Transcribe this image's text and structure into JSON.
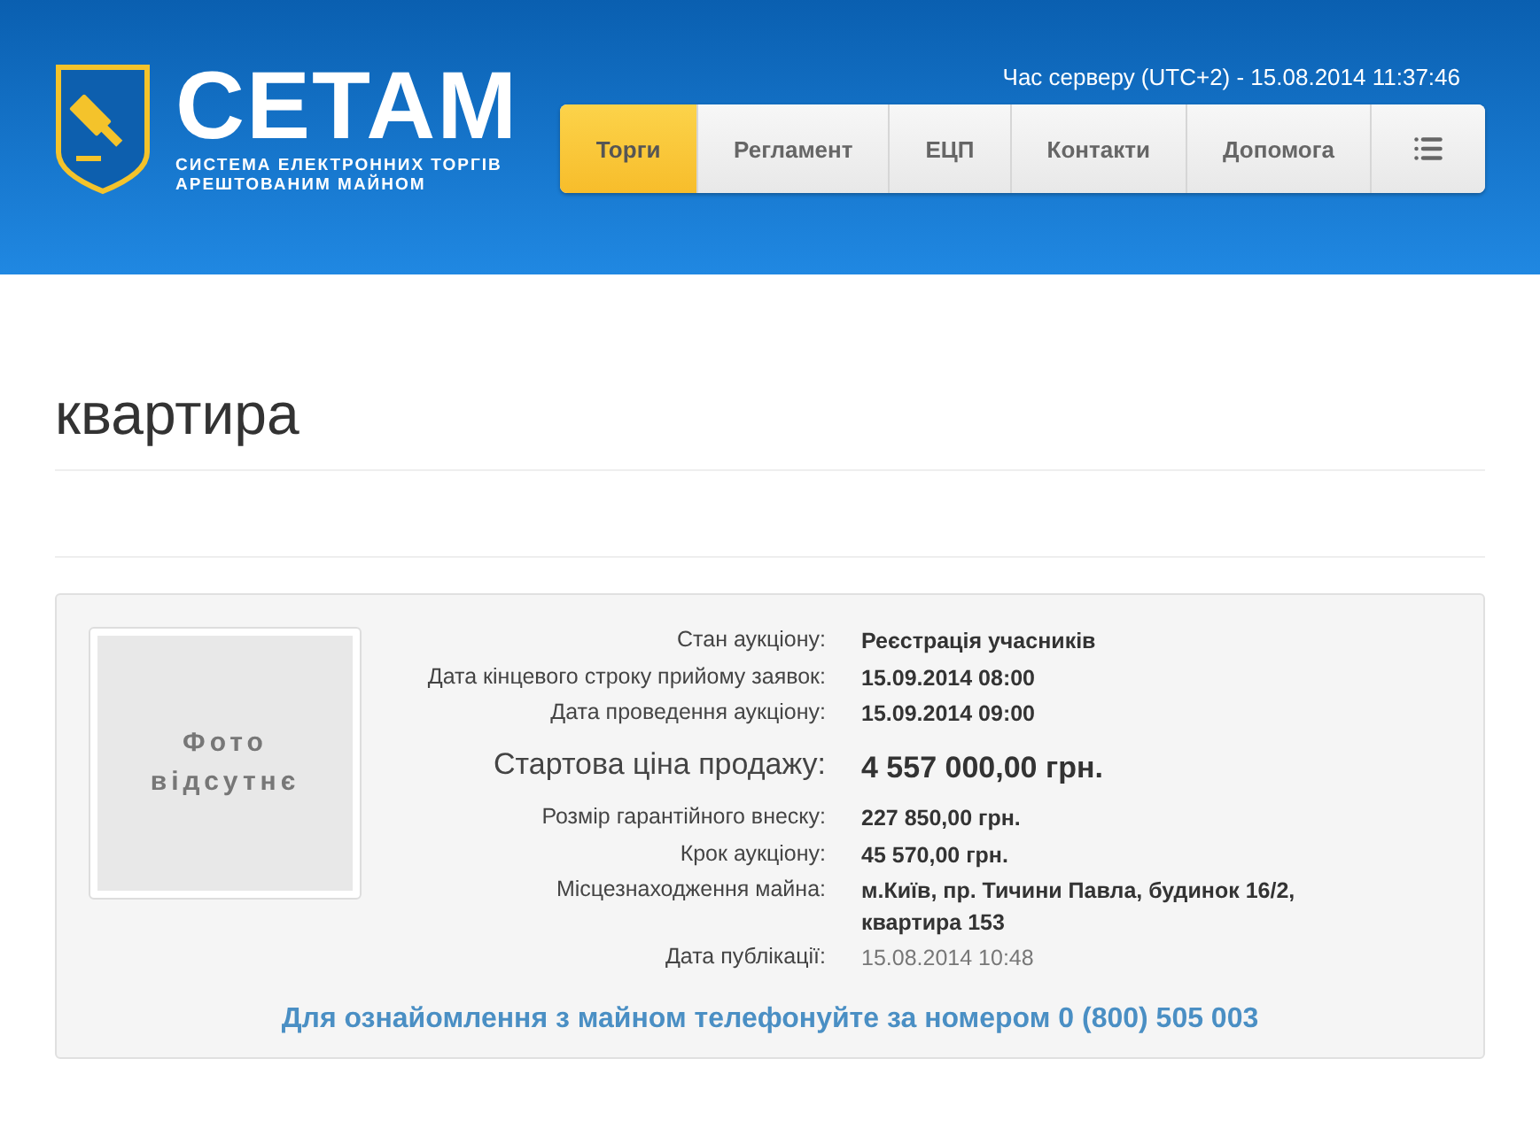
{
  "logo": {
    "title": "СЕТАМ",
    "subtitle_lines": [
      "СИСТЕМА ЕЛЕКТРОННИХ ТОРГІВ",
      "АРЕШТОВАНИМ МАЙНОМ"
    ]
  },
  "server_time": "Час серверу (UTC+2) - 15.08.2014 11:37:46",
  "nav": [
    {
      "label": "Торги",
      "selected": true
    },
    {
      "label": "Регламент",
      "selected": false
    },
    {
      "label": "ЕЦП",
      "selected": false
    },
    {
      "label": "Контакти",
      "selected": false
    },
    {
      "label": "Допомога",
      "selected": false
    }
  ],
  "page_title": "квартира",
  "photo_placeholder_lines": [
    "Фото",
    "відсутнє"
  ],
  "details": [
    {
      "kind": "bold",
      "label": "Стан аукціону:",
      "value": "Реєстрація учасників"
    },
    {
      "kind": "bold",
      "label": "Дата кінцевого строку прийому заявок:",
      "value": "15.09.2014 08:00"
    },
    {
      "kind": "bold",
      "label": "Дата проведення аукціону:",
      "value": "15.09.2014 09:00"
    },
    {
      "kind": "price",
      "label": "Стартова ціна продажу:",
      "value": "4 557 000,00 грн."
    },
    {
      "kind": "bold",
      "label": "Розмір гарантійного внеску:",
      "value": "227 850,00 грн."
    },
    {
      "kind": "bold",
      "label": "Крок аукціону:",
      "value": "45 570,00 грн."
    },
    {
      "kind": "bold",
      "label": "Місцезнаходження майна:",
      "value": "м.Київ, пр. Тичини Павла, будинок 16/2, квартира 153"
    },
    {
      "kind": "plain",
      "label": "Дата публікації:",
      "value": "15.08.2014 10:48"
    }
  ],
  "contact_note": "Для ознайомлення з майном телефонуйте за номером 0 (800) 505 003"
}
